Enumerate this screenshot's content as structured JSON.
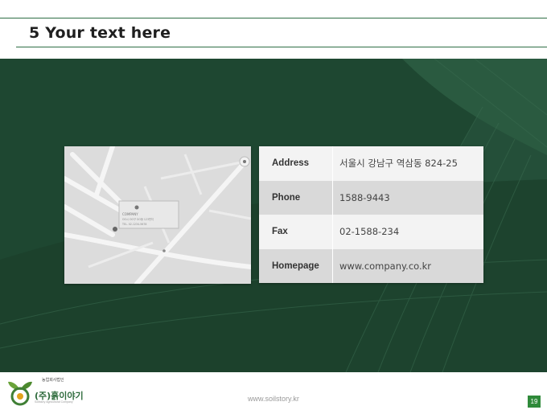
{
  "slide": {
    "title": "5 Your text here",
    "page_number": "19",
    "website": "www.soilstory.kr"
  },
  "logo": {
    "small_text": "농업회사법인",
    "name": "(주)흙이야기",
    "tagline": "Soilstory Agricultural Company"
  },
  "map": {
    "company_label": "COMPANY",
    "lines": [
      "OO시 OO구 OO동 123번지",
      "TEL. 02-1234-5678"
    ]
  },
  "contact": [
    {
      "label": "Address",
      "value": "서울시 강남구 역삼동 824-25"
    },
    {
      "label": "Phone",
      "value": "1588-9443"
    },
    {
      "label": "Fax",
      "value": "02-1588-234"
    },
    {
      "label": "Homepage",
      "value": "www.company.co.kr"
    }
  ],
  "colors": {
    "accent": "#2f6e45",
    "hero_bg": "#1f4a33",
    "page_badge": "#2f8a3a"
  }
}
